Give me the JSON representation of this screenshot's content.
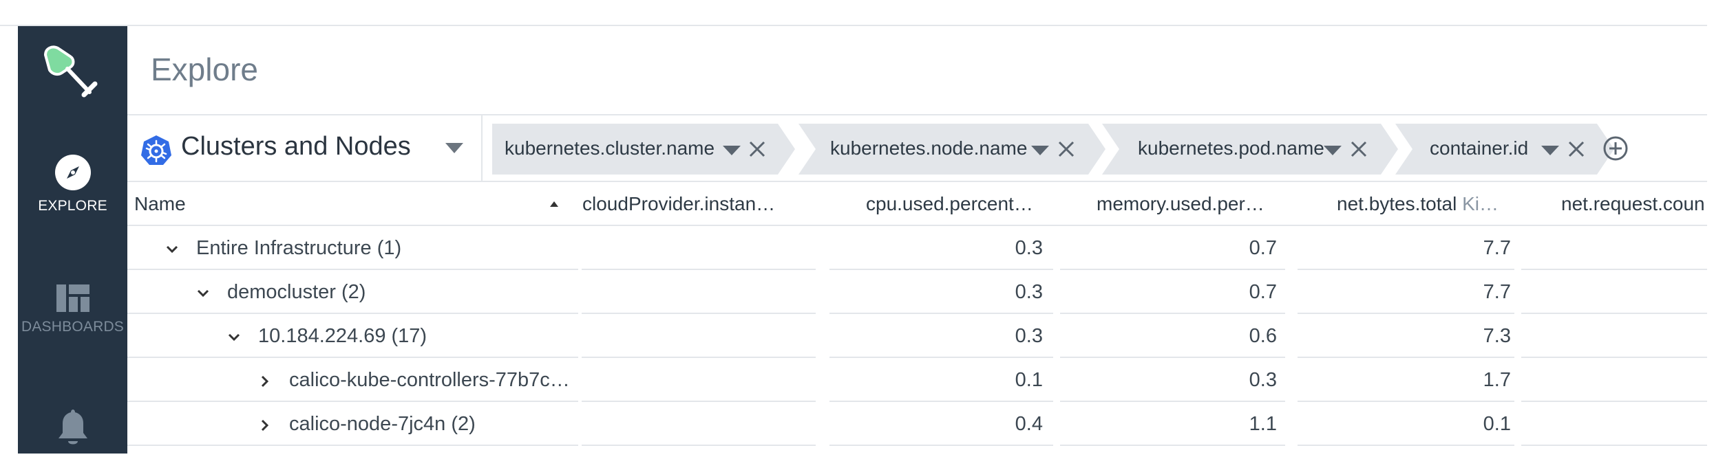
{
  "sidebar": {
    "logo": "shovel-logo-icon",
    "items": [
      {
        "label": "EXPLORE",
        "icon": "compass-icon",
        "active": true
      },
      {
        "label": "DASHBOARDS",
        "icon": "dashboard-icon",
        "active": false
      },
      {
        "label": "",
        "icon": "bell-icon",
        "active": false
      }
    ]
  },
  "header": {
    "title": "Explore"
  },
  "grouping": {
    "selected": "Clusters and Nodes",
    "icon": "kubernetes-icon",
    "chips": [
      {
        "label": "kubernetes.cluster.name"
      },
      {
        "label": "kubernetes.node.name"
      },
      {
        "label": "kubernetes.pod.name"
      },
      {
        "label": "container.id"
      }
    ],
    "add_icon": "add-circle-icon"
  },
  "table": {
    "columns": [
      {
        "label": "Name",
        "unit": ""
      },
      {
        "label": "cloudProvider.instan…",
        "unit": ""
      },
      {
        "label": "cpu.used.percent…",
        "unit": ""
      },
      {
        "label": "memory.used.per…",
        "unit": ""
      },
      {
        "label": "net.bytes.total",
        "unit": "Ki…"
      },
      {
        "label": "net.request.coun",
        "unit": ""
      }
    ],
    "rows": [
      {
        "name": "Entire Infrastructure (1)",
        "expanded": true,
        "cpu": "0.3",
        "memory": "0.7",
        "net": "7.7"
      },
      {
        "name": "democluster (2)",
        "expanded": true,
        "cpu": "0.3",
        "memory": "0.7",
        "net": "7.7"
      },
      {
        "name": "10.184.224.69 (17)",
        "expanded": true,
        "cpu": "0.3",
        "memory": "0.6",
        "net": "7.3"
      },
      {
        "name": "calico-kube-controllers-77b7c…",
        "expanded": false,
        "cpu": "0.1",
        "memory": "0.3",
        "net": "1.7"
      },
      {
        "name": "calico-node-7jc4n (2)",
        "expanded": false,
        "cpu": "0.4",
        "memory": "1.1",
        "net": "0.1"
      }
    ]
  },
  "colors": {
    "sidebar_bg": "#253444",
    "accent_green": "#6fcf97",
    "chip_bg": "#e3e6ea",
    "k8s_blue": "#326ce5"
  }
}
